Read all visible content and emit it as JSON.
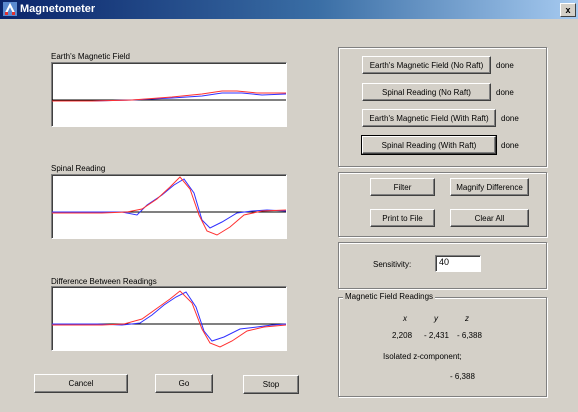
{
  "window": {
    "title": "Magnetometer",
    "close_glyph": "x"
  },
  "plots": {
    "earth": {
      "label": "Earth's Magnetic Field"
    },
    "spinal": {
      "label": "Spinal Reading"
    },
    "diff": {
      "label": "Difference Between Readings"
    }
  },
  "measure": {
    "earth_no_raft": {
      "label": "Earth's Magnetic Field (No Raft)",
      "status": "done"
    },
    "spinal_no_raft": {
      "label": "Spinal Reading (No Raft)",
      "status": "done"
    },
    "earth_with_raft": {
      "label": "Earth's Magnetic Field (With Raft)",
      "status": "done"
    },
    "spinal_with_raft": {
      "label": "Spinal Reading (With Raft)",
      "status": "done"
    }
  },
  "tools": {
    "filter": "Filter",
    "magnify": "Magnify Difference",
    "print": "Print to File",
    "clear": "Clear All"
  },
  "sensitivity": {
    "label": "Sensitivity:",
    "value": "40"
  },
  "readings": {
    "title": "Magnetic Field Readings",
    "x_label": "x",
    "y_label": "y",
    "z_label": "z",
    "x_value": "2,208",
    "y_value": "- 2,431",
    "z_value": "- 6,388",
    "isolated_label": "Isolated z-component;",
    "isolated_value": "- 6,388"
  },
  "actions": {
    "cancel": "Cancel",
    "go": "Go",
    "stop": "Stop"
  },
  "colors": {
    "series_red": "#ff3030",
    "series_blue": "#3030ff",
    "baseline": "#000000"
  }
}
